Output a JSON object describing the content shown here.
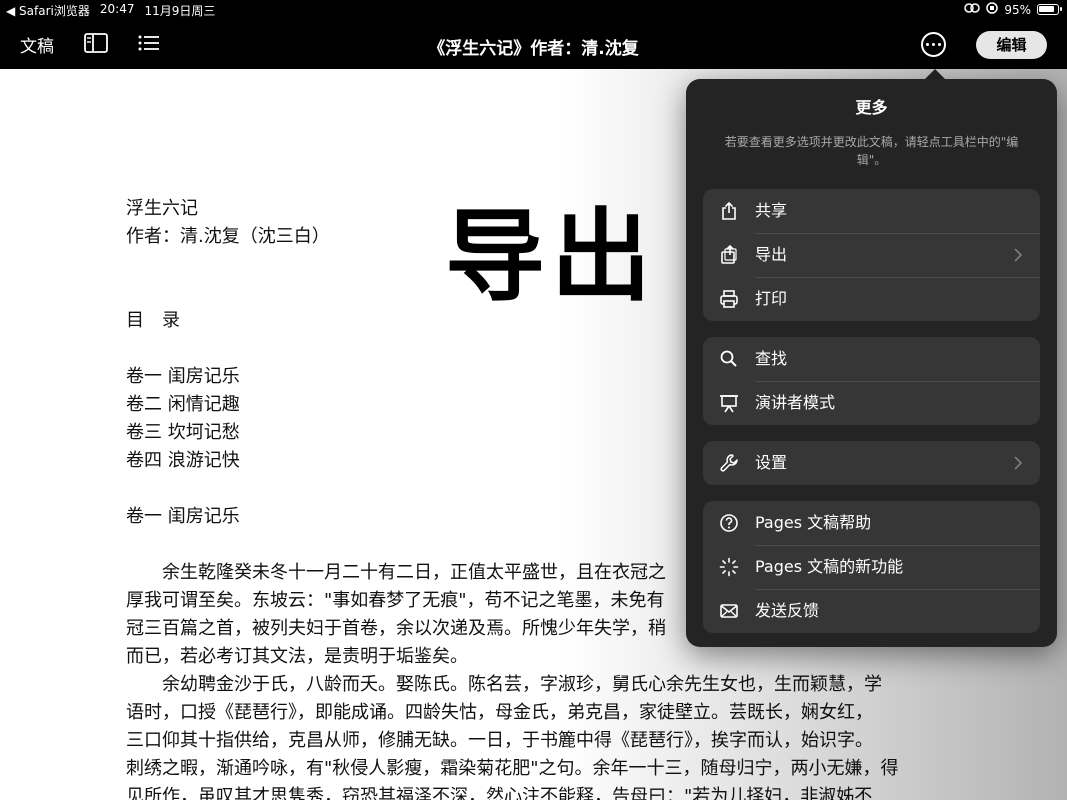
{
  "status_bar": {
    "back_app": "◀ Safari浏览器",
    "time": "20:47",
    "date": "11月9日周三",
    "battery_text": "95%"
  },
  "toolbar": {
    "documents_label": "文稿",
    "title": "《浮生六记》作者：清.沈复",
    "edit_label": "编辑"
  },
  "document": {
    "heading_title": "浮生六记",
    "heading_author": "作者：清.沈复（沈三白）",
    "toc_heading": "目　录",
    "toc": [
      "卷一 闺房记乐",
      "卷二 闲情记趣",
      "卷三 坎坷记愁",
      "卷四 浪游记快"
    ],
    "section_heading": "卷一 闺房记乐",
    "paragraph_lines": [
      "　　余生乾隆癸未冬十一月二十有二日，正值太平盛世，且在衣冠之",
      "厚我可谓至矣。东坡云：\"事如春梦了无痕\"，苟不记之笔墨，未免有",
      "冠三百篇之首，被列夫妇于首卷，余以次递及焉。所愧少年失学，稍",
      "而已，若必考订其文法，是责明于垢鉴矣。",
      "　　余幼聘金沙于氏，八龄而夭。娶陈氏。陈名芸，字淑珍，舅氏心余先生女也，生而颖慧，学",
      "语时，口授《琵琶行》，即能成诵。四龄失怙，母金氏，弟克昌，家徒壁立。芸既长，娴女红，",
      "三口仰其十指供给，克昌从师，修脯无缺。一日，于书簏中得《琵琶行》，挨字而认，始识字。",
      "刺绣之暇，渐通吟咏，有\"秋侵人影瘦，霜染菊花肥\"之句。余年一十三，随母归宁，两小无嫌，得",
      "见所作，虽叹其才思隽秀，窃恐其福泽不深，然心注不能释，告母曰：\"若为儿择妇，非淑姊不"
    ],
    "overlay_text": "导出"
  },
  "popover": {
    "title": "更多",
    "hint": "若要查看更多选项并更改此文稿，请轻点工具栏中的\"编辑\"。",
    "groups": [
      [
        {
          "label": "共享",
          "icon": "share-icon"
        },
        {
          "label": "导出",
          "icon": "export-icon",
          "chevron": true
        },
        {
          "label": "打印",
          "icon": "printer-icon"
        }
      ],
      [
        {
          "label": "查找",
          "icon": "magnifier-icon"
        },
        {
          "label": "演讲者模式",
          "icon": "presenter-icon"
        }
      ],
      [
        {
          "label": "设置",
          "icon": "wrench-icon",
          "chevron": true
        }
      ],
      [
        {
          "label": "Pages 文稿帮助",
          "icon": "help-icon"
        },
        {
          "label": "Pages 文稿的新功能",
          "icon": "sparkle-icon"
        },
        {
          "label": "发送反馈",
          "icon": "mail-icon"
        }
      ]
    ]
  },
  "colors": {
    "popover_bg": "#242424",
    "group_bg": "#363636",
    "toolbar_bg": "#000000"
  }
}
